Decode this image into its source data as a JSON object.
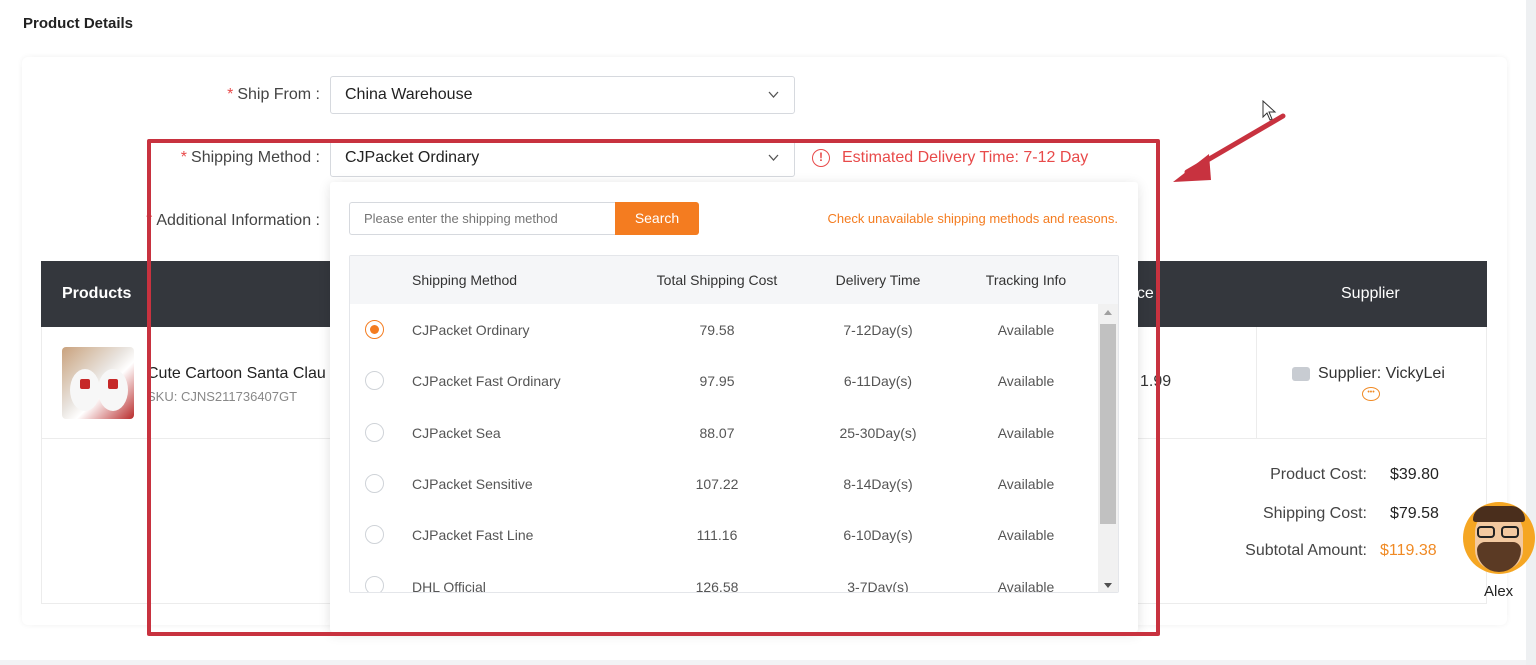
{
  "section_title": "Product Details",
  "form": {
    "ship_from": {
      "required_mark": "*",
      "label": "Ship From :",
      "value": "China Warehouse"
    },
    "shipping_method": {
      "required_mark": "*",
      "label": "Shipping Method :",
      "value": "CJPacket Ordinary"
    },
    "additional_info": {
      "required_mark": "*",
      "label": "Additional Information :"
    },
    "estimated_delivery": "Estimated Delivery Time: 7-12 Day"
  },
  "product_table": {
    "headers": {
      "products": "Products",
      "price": "rice",
      "supplier": "Supplier"
    },
    "row": {
      "name": "Cute Cartoon Santa Clau",
      "sku": "SKU: CJNS211736407GT",
      "price": "1.99",
      "supplier": "Supplier: VickyLei"
    }
  },
  "summary": {
    "product_cost_label": "Product Cost:",
    "product_cost": "$39.80",
    "shipping_cost_label": "Shipping Cost:",
    "shipping_cost": "$79.58",
    "subtotal_label": "Subtotal Amount:",
    "subtotal": "$119.38"
  },
  "dropdown": {
    "search_placeholder": "Please enter the shipping method",
    "search_button": "Search",
    "check_link": "Check unavailable shipping methods and reasons.",
    "columns": [
      "Shipping Method",
      "Total Shipping Cost",
      "Delivery Time",
      "Tracking Info"
    ],
    "rows": [
      {
        "name": "CJPacket Ordinary",
        "cost": "79.58",
        "time": "7-12Day(s)",
        "tracking": "Available",
        "selected": true
      },
      {
        "name": "CJPacket Fast Ordinary",
        "cost": "97.95",
        "time": "6-11Day(s)",
        "tracking": "Available",
        "selected": false
      },
      {
        "name": "CJPacket Sea",
        "cost": "88.07",
        "time": "25-30Day(s)",
        "tracking": "Available",
        "selected": false
      },
      {
        "name": "CJPacket Sensitive",
        "cost": "107.22",
        "time": "8-14Day(s)",
        "tracking": "Available",
        "selected": false
      },
      {
        "name": "CJPacket Fast Line",
        "cost": "111.16",
        "time": "6-10Day(s)",
        "tracking": "Available",
        "selected": false
      },
      {
        "name": "DHL Official",
        "cost": "126.58",
        "time": "3-7Day(s)",
        "tracking": "Available",
        "selected": false
      }
    ]
  },
  "assistant": {
    "name": "Alex"
  },
  "colors": {
    "accent": "#f47c20",
    "warning": "#e84a4a",
    "highlight": "#c8323f",
    "header_bg": "#34373d"
  }
}
